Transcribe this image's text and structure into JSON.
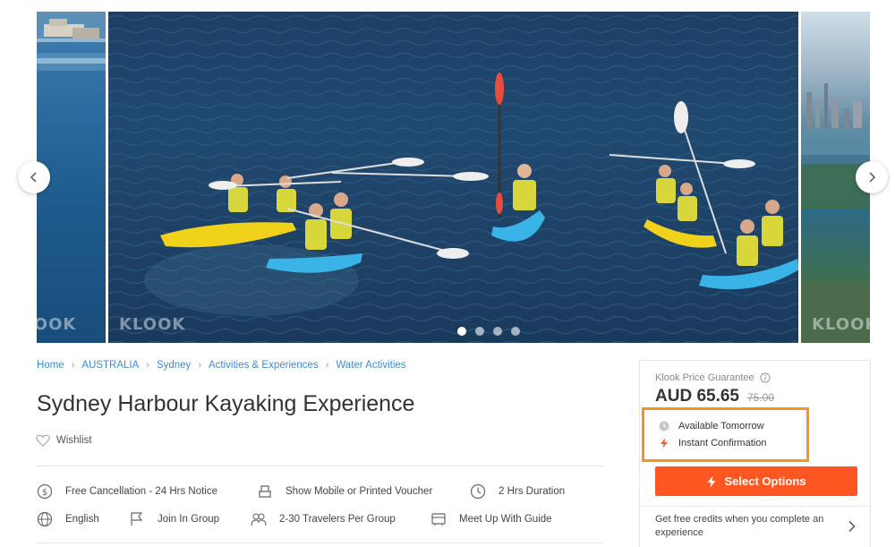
{
  "gallery": {
    "watermark": "KLOOK",
    "prev_icon": "chevron-left-icon",
    "next_icon": "chevron-right-icon",
    "slide_count": 4,
    "active_slide": 1
  },
  "breadcrumb": {
    "items": [
      "Home",
      "AUSTRALIA",
      "Sydney",
      "Activities & Experiences",
      "Water Activities"
    ]
  },
  "activity": {
    "title": "Sydney Harbour Kayaking Experience",
    "wishlist_label": "Wishlist"
  },
  "features": [
    {
      "label": "Free Cancellation - 24 Hrs Notice",
      "icon": "cancellation-dollar-icon"
    },
    {
      "label": "Show Mobile or Printed Voucher",
      "icon": "voucher-icon"
    },
    {
      "label": "2 Hrs Duration",
      "icon": "clock-icon"
    },
    {
      "label": "English",
      "icon": "globe-icon"
    },
    {
      "label": "Join In Group",
      "icon": "flag-icon"
    },
    {
      "label": "2-30 Travelers Per Group",
      "icon": "group-icon"
    },
    {
      "label": "Meet Up With Guide",
      "icon": "meetup-icon"
    }
  ],
  "booking": {
    "guarantee_label": "Klook Price Guarantee",
    "price": "AUD 65.65",
    "original_price": "75.00",
    "availability": "Available Tomorrow",
    "confirmation": "Instant Confirmation",
    "select_label": "Select Options",
    "credits_text": "Get free credits when you complete an experience"
  },
  "colors": {
    "accent": "#ff5722",
    "link": "#3c8bd9",
    "highlight": "#f7941d"
  }
}
